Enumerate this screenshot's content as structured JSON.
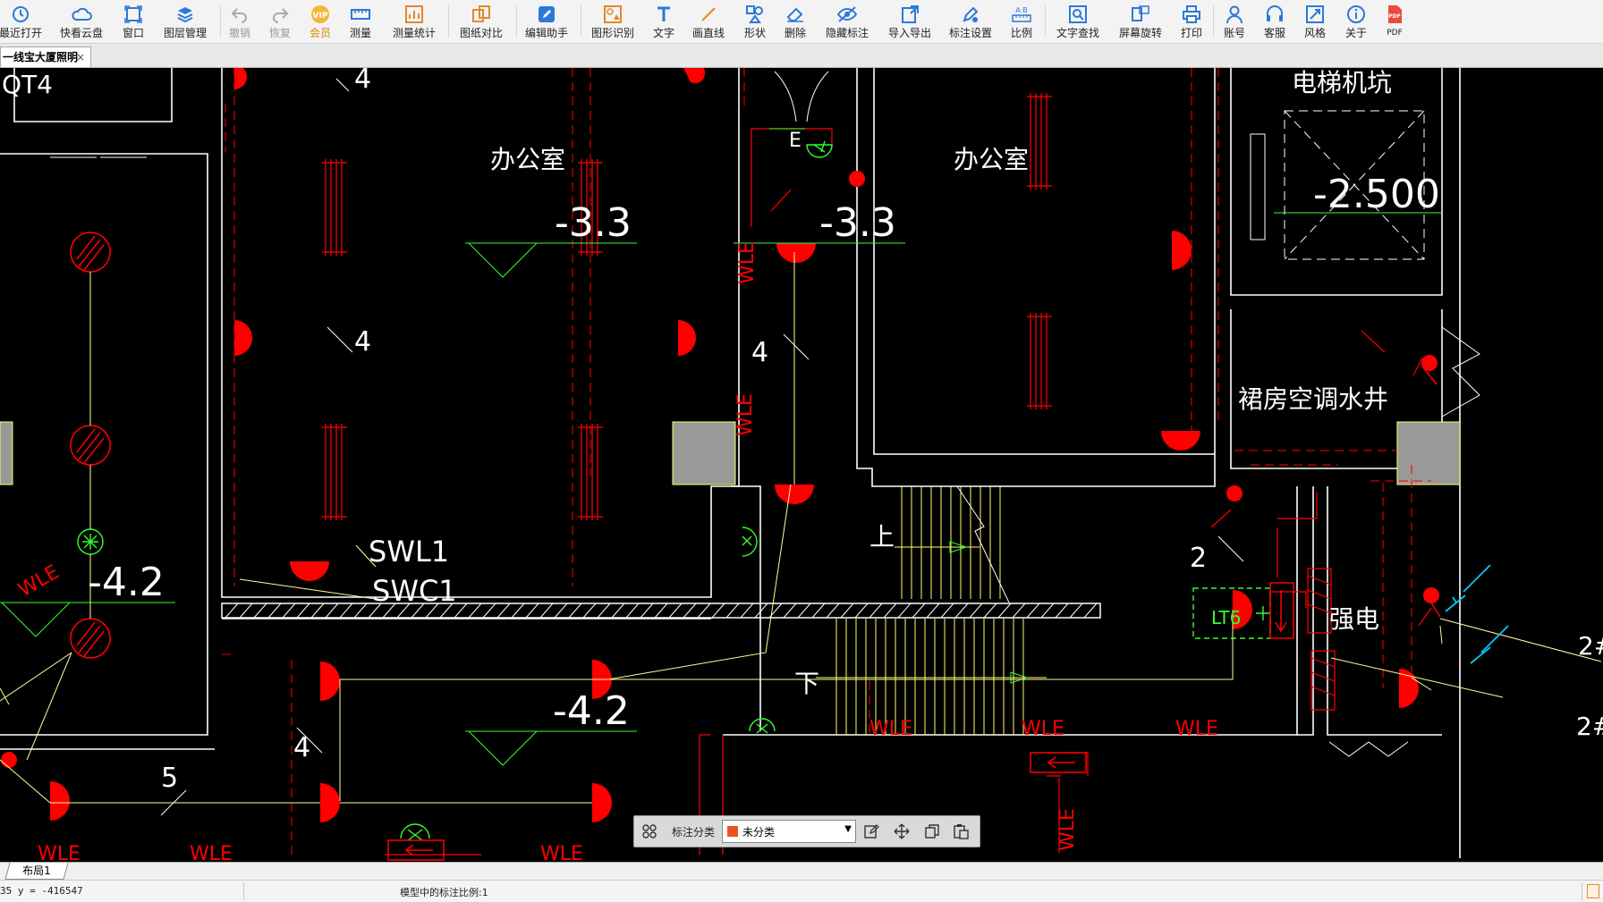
{
  "toolbar": {
    "items": [
      {
        "label": "最近打开",
        "icon": "history-icon"
      },
      {
        "label": "快看云盘",
        "icon": "cloud-icon"
      },
      {
        "label": "窗口",
        "icon": "window-icon"
      },
      {
        "label": "图层管理",
        "icon": "layers-icon"
      },
      {
        "label": "撤销",
        "icon": "undo-icon"
      },
      {
        "label": "恢复",
        "icon": "redo-icon"
      },
      {
        "label": "会员",
        "icon": "vip-icon"
      },
      {
        "label": "测量",
        "icon": "ruler-icon"
      },
      {
        "label": "测量统计",
        "icon": "measure-stats-icon"
      },
      {
        "label": "图纸对比",
        "icon": "compare-icon"
      },
      {
        "label": "编辑助手",
        "icon": "edit-assistant-icon"
      },
      {
        "label": "图形识别",
        "icon": "shape-recognize-icon"
      },
      {
        "label": "文字",
        "icon": "text-icon"
      },
      {
        "label": "画直线",
        "icon": "line-icon"
      },
      {
        "label": "形状",
        "icon": "shape-icon"
      },
      {
        "label": "删除",
        "icon": "eraser-icon"
      },
      {
        "label": "隐藏标注",
        "icon": "hide-annotation-icon"
      },
      {
        "label": "导入导出",
        "icon": "import-export-icon"
      },
      {
        "label": "标注设置",
        "icon": "annotation-settings-icon"
      },
      {
        "label": "比例",
        "icon": "scale-icon"
      },
      {
        "label": "文字查找",
        "icon": "text-search-icon"
      },
      {
        "label": "屏幕旋转",
        "icon": "rotate-screen-icon"
      },
      {
        "label": "打印",
        "icon": "printer-icon"
      },
      {
        "label": "账号",
        "icon": "account-icon"
      },
      {
        "label": "客服",
        "icon": "headset-icon"
      },
      {
        "label": "风格",
        "icon": "style-icon"
      },
      {
        "label": "关于",
        "icon": "info-icon"
      },
      {
        "label": "PDF",
        "icon": "pdf-icon"
      }
    ]
  },
  "document_tab": {
    "label": "一线宝大厦照明",
    "close": "×"
  },
  "drawing": {
    "rooms": [
      "办公室",
      "办公室",
      "电梯机坑",
      "裙房空调水井"
    ],
    "elevations": [
      "-3.3",
      "-3.3",
      "-2.500",
      "-4.2",
      "-4.2"
    ],
    "tags": [
      "QT4",
      "SWL1",
      "SWC1",
      "E",
      "LT6",
      "强电",
      "上",
      "下"
    ],
    "counts": [
      "4",
      "4",
      "4",
      "4",
      "5",
      "2",
      "2#",
      "2#"
    ],
    "line_label": "WLE"
  },
  "floating_bar": {
    "category_label": "标注分类",
    "category_value": "未分类"
  },
  "layout_tab": {
    "label": "布局1"
  },
  "status": {
    "coords": "35 y = -416547",
    "scale_text": "模型中的标注比例:1"
  },
  "colors": {
    "red": "#ff0000",
    "green": "#33ff33",
    "white": "#ffffff",
    "yellow": "#ffff66",
    "cyan": "#00ccff",
    "accent": "#e8541e"
  }
}
